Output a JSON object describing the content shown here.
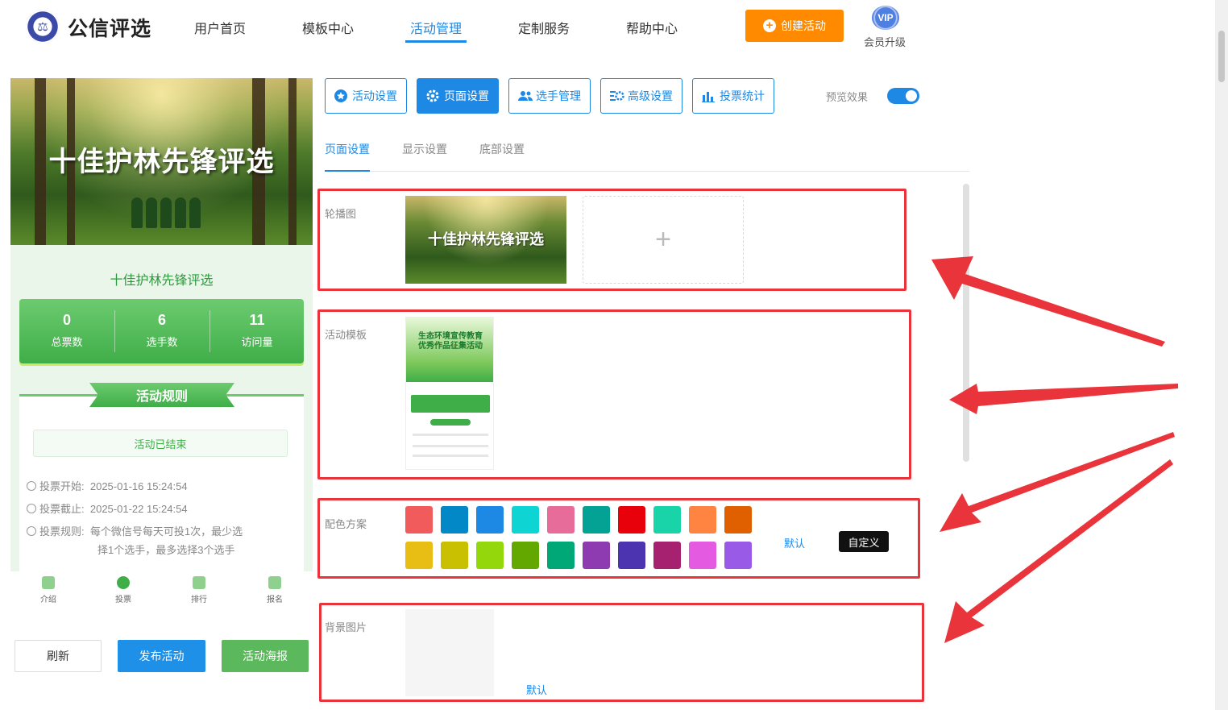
{
  "header": {
    "logo_mark": "⚖",
    "logo_text": "公信评选",
    "nav": [
      "用户首页",
      "模板中心",
      "活动管理",
      "定制服务",
      "帮助中心"
    ],
    "active_nav": "活动管理",
    "create_button": "创建活动",
    "vip_badge": "VIP",
    "vip_label": "会员升级"
  },
  "preview": {
    "banner_title": "十佳护林先锋评选",
    "activity_title": "十佳护林先锋评选",
    "stats": [
      {
        "value": "0",
        "label": "总票数"
      },
      {
        "value": "6",
        "label": "选手数"
      },
      {
        "value": "11",
        "label": "访问量"
      }
    ],
    "rules_title": "活动规则",
    "status": "活动已结束",
    "vote_start_label": "投票开始:",
    "vote_start": "2025-01-16 15:24:54",
    "vote_end_label": "投票截止:",
    "vote_end": "2025-01-22 15:24:54",
    "vote_rule_label": "投票规则:",
    "vote_rule_line1": "每个微信号每天可投1次，最少选",
    "vote_rule_line2": "择1个选手，最多选择3个选手",
    "tabbar": [
      "介绍",
      "投票",
      "排行",
      "报名"
    ],
    "active_tab": "投票"
  },
  "actions": {
    "refresh": "刷新",
    "publish": "发布活动",
    "poster": "活动海报"
  },
  "settings": {
    "tabs": [
      "活动设置",
      "页面设置",
      "选手管理",
      "高级设置",
      "投票统计"
    ],
    "active_tab": "页面设置",
    "preview_label": "预览效果",
    "preview_on": true,
    "subtabs": [
      "页面设置",
      "显示设置",
      "底部设置"
    ],
    "active_subtab": "页面设置"
  },
  "page_settings": {
    "carousel_label": "轮播图",
    "carousel_image_title": "十佳护林先锋评选",
    "upload_plus": "+",
    "template_label": "活动模板",
    "template_title_1": "生态环境宣传教育",
    "template_title_2": "优秀作品征集活动",
    "color_label": "配色方案",
    "colors": [
      "#f25b5b",
      "#0288c7",
      "#1e88e5",
      "#0fd4d4",
      "#e86c9a",
      "#04a294",
      "#e8000b",
      "#18d4a8",
      "#ff8442",
      "#e06000",
      "#e8be14",
      "#c8c000",
      "#94d80c",
      "#62a800",
      "#00a878",
      "#8e3ab0",
      "#4c33b0",
      "#a62270",
      "#e45ae0",
      "#9a5ae8"
    ],
    "color_default": "默认",
    "color_custom": "自定义",
    "background_label": "背景图片",
    "background_default": "默认"
  },
  "colors": {
    "accent": "#1e88e5",
    "orange": "#ff8a00",
    "green": "#3fae48",
    "highlight_red": "#e8343a"
  }
}
